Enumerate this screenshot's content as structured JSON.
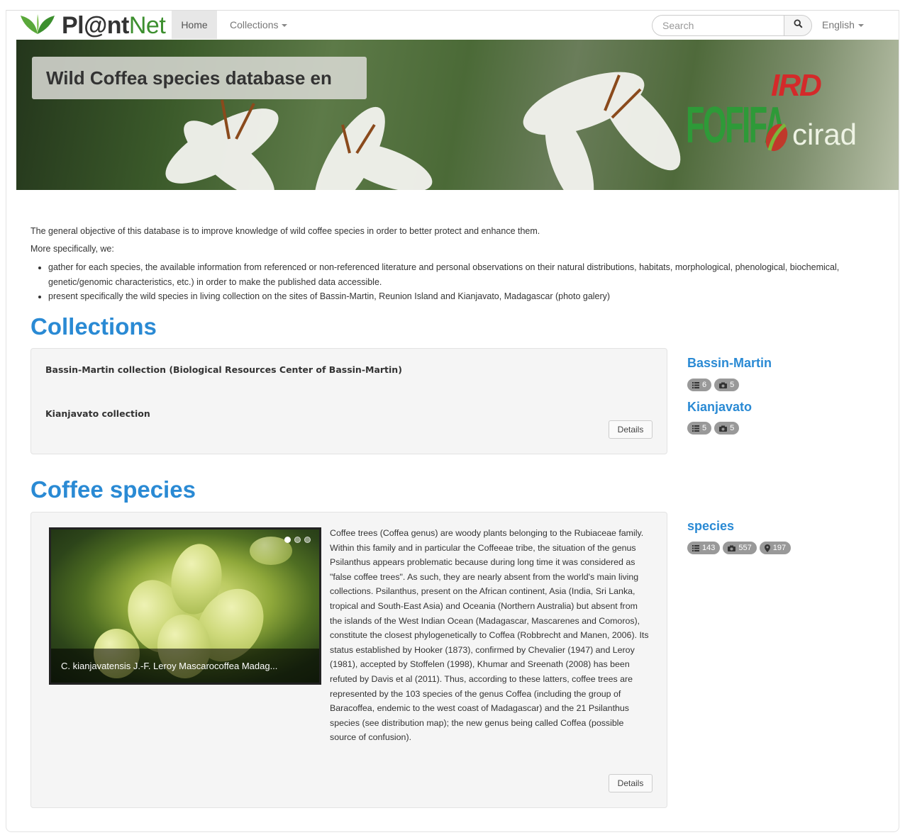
{
  "navbar": {
    "brand_part1": "Pl@nt",
    "brand_part2": "Net",
    "home_label": "Home",
    "collections_label": "Collections",
    "search_placeholder": "Search",
    "language_label": "English"
  },
  "banner": {
    "title": "Wild Coffea species database en",
    "logo_ird": "IRD",
    "logo_cirad": "cirad",
    "logo_fofifa": "FOFIFA"
  },
  "intro": {
    "paragraph1": "The general objective of this database is to improve knowledge of wild coffee species in order to better protect and enhance them.",
    "paragraph2": "More specifically, we:",
    "bullets": [
      "gather for each species, the available information from referenced or non-referenced literature and personal observations on their natural distributions, habitats, morphological, phenological, biochemical, genetic/genomic characteristics, etc.) in order to make the published data accessible.",
      "present specifically the wild species in living collection on the sites of Bassin-Martin, Reunion Island and Kianjavato, Madagascar (photo galery)"
    ]
  },
  "collections": {
    "heading": "Collections",
    "items": [
      "Bassin-Martin collection (Biological Resources Center of Bassin-Martin)",
      "Kianjavato collection"
    ],
    "details_label": "Details",
    "sidebar": [
      {
        "name": "Bassin-Martin",
        "list_count": "6",
        "photo_count": "5"
      },
      {
        "name": "Kianjavato",
        "list_count": "5",
        "photo_count": "5"
      }
    ]
  },
  "species": {
    "heading": "Coffee species",
    "carousel_caption": "C. kianjavatensis J.-F. Leroy Mascarocoffea Madag...",
    "description": "Coffee trees (Coffea genus) are woody plants belonging to the Rubiaceae family. Within this family and in particular the Coffeeae tribe, the situation of the genus Psilanthus appears problematic because during long time it was considered as \"false coffee trees\". As such, they are nearly absent from the world's main living collections. Psilanthus, present on the African continent, Asia (India, Sri Lanka, tropical and South-East Asia) and Oceania (Northern Australia) but absent from the islands of the West Indian Ocean (Madagascar, Mascarenes and Comoros), constitute the closest phylogenetically to Coffea (Robbrecht and Manen, 2006). Its status established by Hooker (1873), confirmed by Chevalier (1947) and Leroy (1981), accepted by Stoffelen (1998), Khumar and Sreenath (2008) has been refuted by Davis et al (2011). Thus, according to these latters, coffee trees are represented by the 103 species of the genus Coffea (including the group of Baracoffea, endemic to the west coast of Madagascar) and the 21 Psilanthus species (see distribution map); the new genus being called Coffea (possible source of confusion).",
    "details_label": "Details",
    "sidebar": {
      "name": "species",
      "list_count": "143",
      "photo_count": "557",
      "location_count": "197"
    }
  },
  "colors": {
    "accent": "#2a8ad4",
    "brand_green": "#3c8f2e",
    "badge": "#999999"
  },
  "icons": [
    "plantnet-leaf-icon",
    "search-icon",
    "caret-down-icon",
    "list-icon",
    "camera-icon",
    "map-marker-icon"
  ]
}
